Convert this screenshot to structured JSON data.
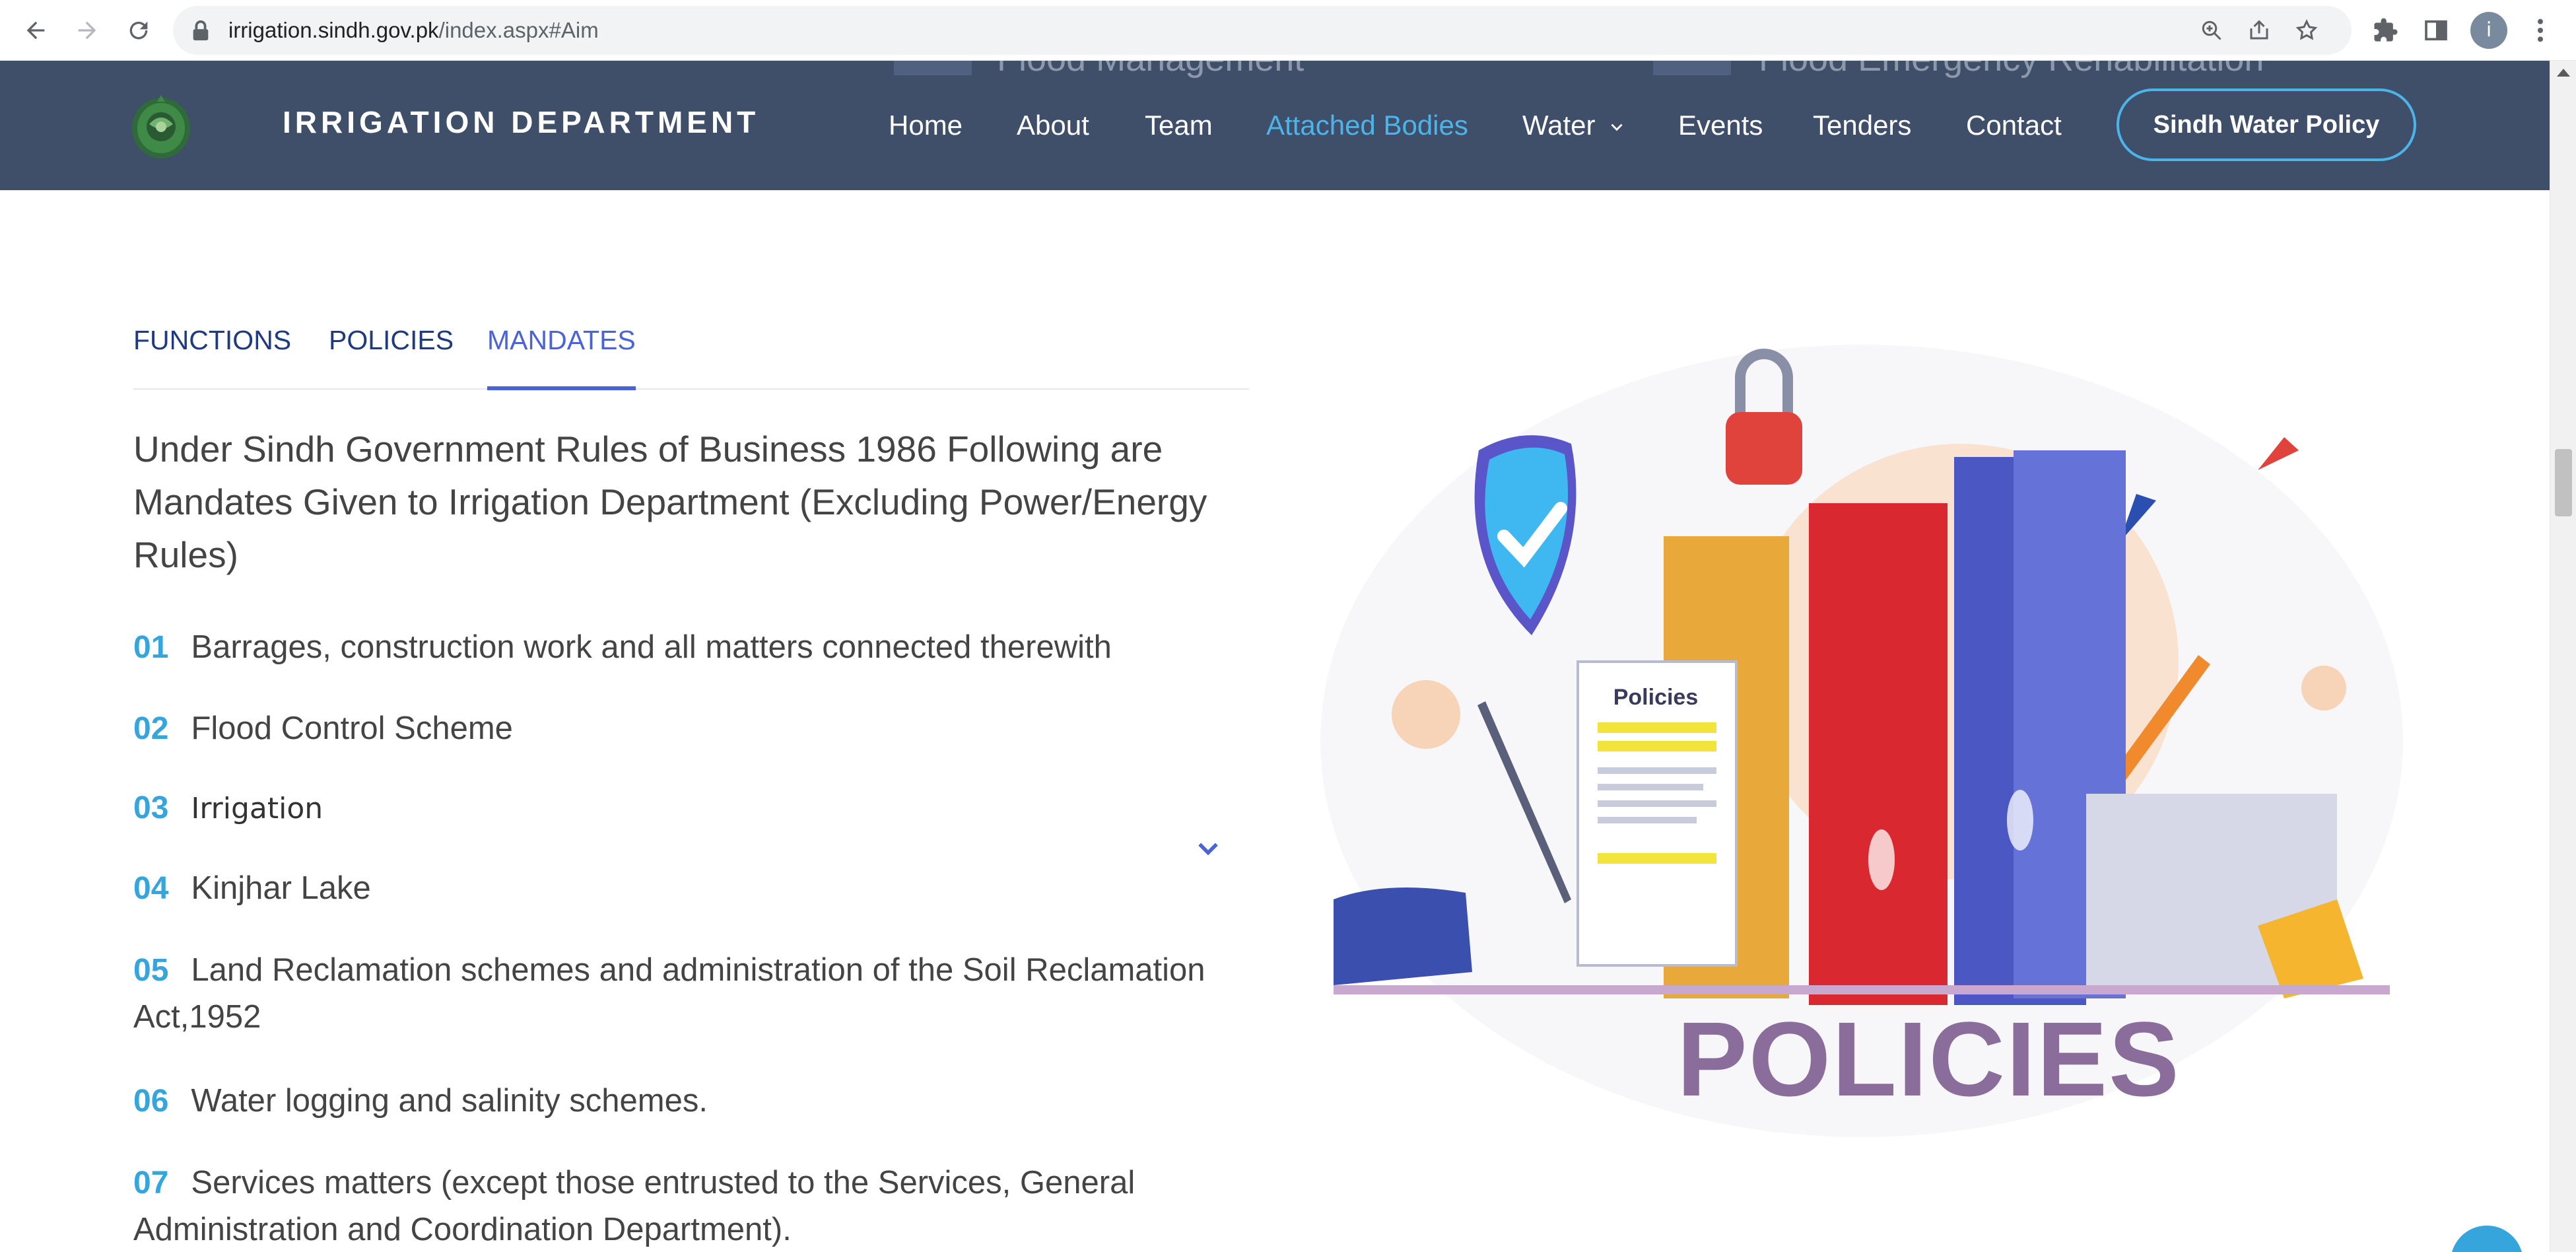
{
  "browser": {
    "url_host": "irrigation.sindh.gov.pk",
    "url_path": "/index.aspx#Aim",
    "profile_initial": "i"
  },
  "site": {
    "peek_left": "Flood Management",
    "peek_right": "Flood Emergency Rehabilitation",
    "brand_title": "IRRIGATION DEPARTMENT",
    "nav": {
      "home": "Home",
      "about": "About",
      "team": "Team",
      "attached_bodies": "Attached Bodies",
      "water": "Water",
      "events": "Events",
      "tenders": "Tenders",
      "contact": "Contact"
    },
    "policy_button": "Sindh Water Policy",
    "accent_color": "#4cb4e8",
    "header_color": "#3f4e69"
  },
  "tabs": {
    "functions": "FUNCTIONS",
    "policies": "POLICIES",
    "mandates": "MANDATES",
    "active": "MANDATES"
  },
  "intro": "Under Sindh Government Rules of Business 1986 Following are Mandates Given to Irrigation Department (Excluding Power/Energy Rules)",
  "mandates": [
    {
      "num": "01",
      "text": "Barrages, construction work and all matters connected therewith"
    },
    {
      "num": "02",
      "text": "Flood Control Scheme"
    },
    {
      "num": "03",
      "text": "Irrigation"
    },
    {
      "num": "04",
      "text": "Kinjhar Lake"
    },
    {
      "num": "05",
      "text": "Land Reclamation schemes and administration of the Soil Reclamation Act,1952"
    },
    {
      "num": "06",
      "text": "Water logging and salinity schemes."
    },
    {
      "num": "07",
      "text": "Services matters (except those entrusted to the Services, General Administration and Coordination Department)."
    }
  ],
  "illustration": {
    "document_label": "Policies",
    "caption": "POLICIES"
  }
}
